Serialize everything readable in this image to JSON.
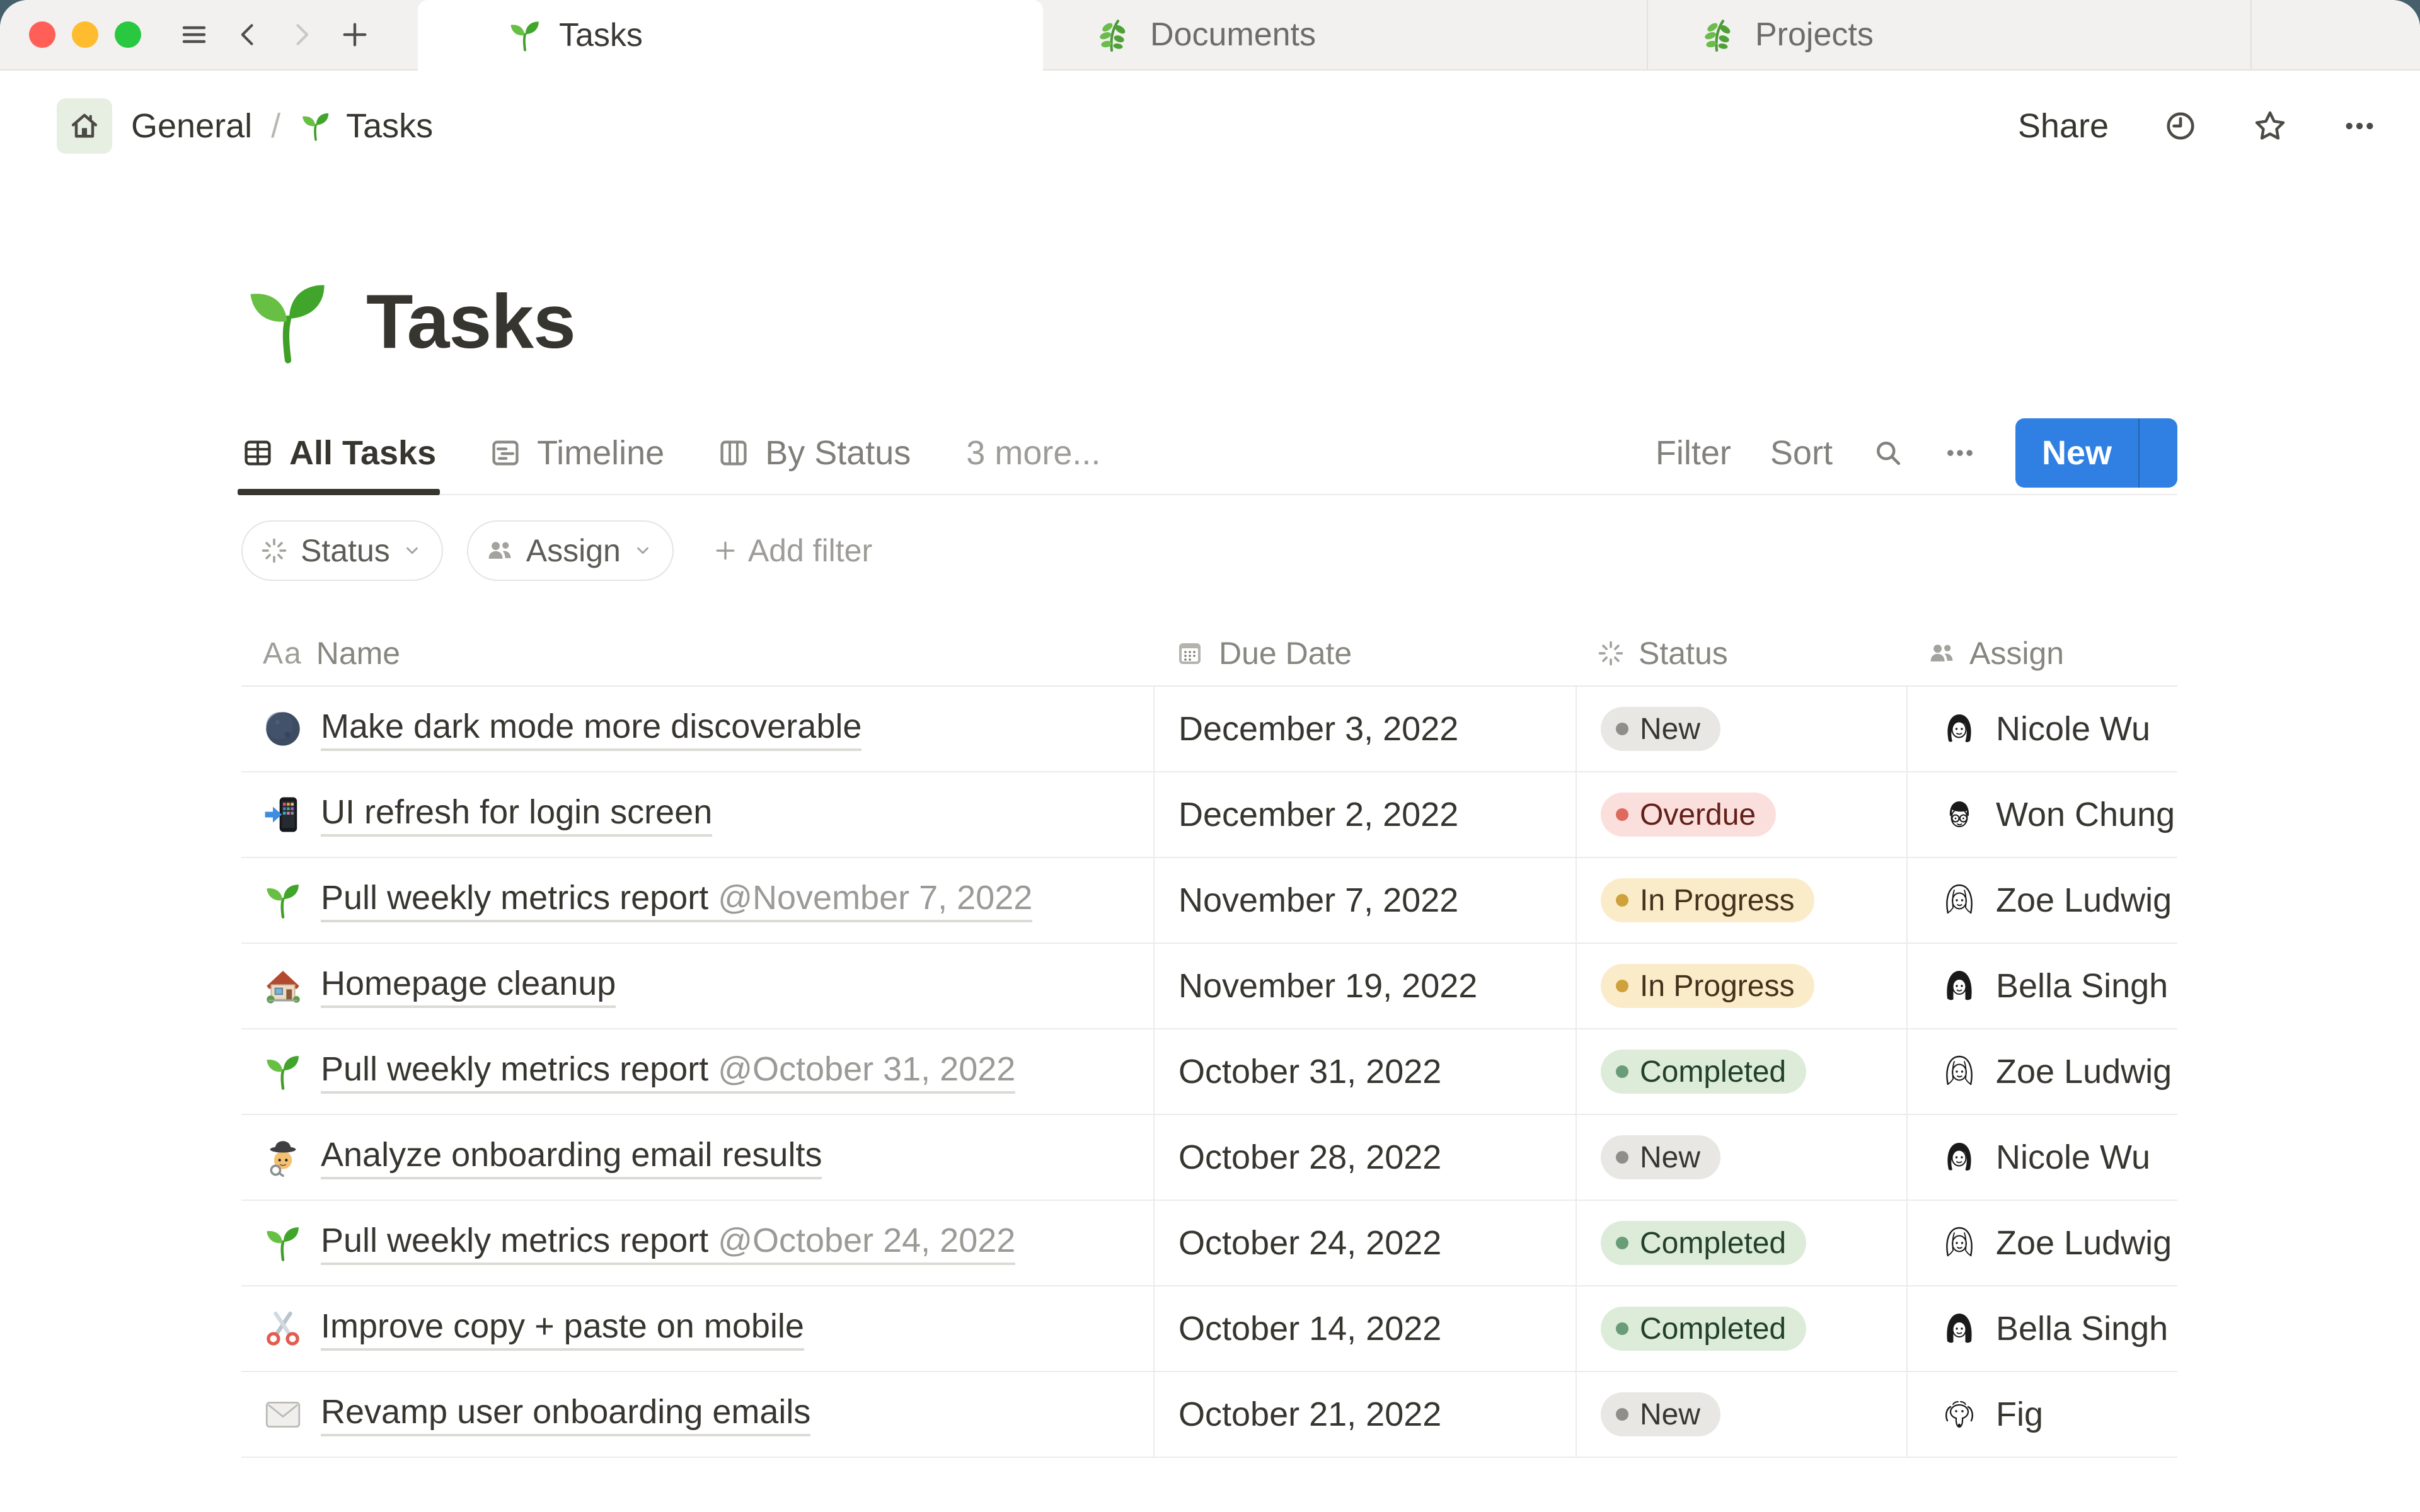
{
  "window": {
    "backdrop_color": "#45606a",
    "traffic_lights": [
      "#ff5f57",
      "#febc2e",
      "#28c840"
    ]
  },
  "tab_bar": {
    "tabs": [
      {
        "label": "Tasks",
        "icon": "seedling-icon",
        "active": true
      },
      {
        "label": "Documents",
        "icon": "herb-icon",
        "active": false
      },
      {
        "label": "Projects",
        "icon": "herb-icon",
        "active": false
      }
    ],
    "nav_icons": [
      "hamburger-icon",
      "chevron-left-icon",
      "chevron-right-icon",
      "plus-icon"
    ]
  },
  "breadcrumb": {
    "home_icon": "home-icon",
    "items": [
      {
        "label": "General"
      },
      {
        "label": "Tasks",
        "icon": "seedling-icon"
      }
    ],
    "separator": "/"
  },
  "toolbar": {
    "share_label": "Share",
    "icons": [
      "clock-icon",
      "star-icon",
      "ellipsis-icon"
    ]
  },
  "page": {
    "icon": "seedling-icon",
    "title": "Tasks"
  },
  "views": {
    "tabs": [
      {
        "label": "All Tasks",
        "icon": "table-view-icon",
        "active": true
      },
      {
        "label": "Timeline",
        "icon": "timeline-view-icon",
        "active": false
      },
      {
        "label": "By Status",
        "icon": "board-view-icon",
        "active": false
      }
    ],
    "more_label": "3 more...",
    "controls": {
      "filter_label": "Filter",
      "sort_label": "Sort",
      "search_icon": "search-icon",
      "more_icon": "ellipsis-gray-icon",
      "new_button": {
        "label": "New",
        "color": "#2f80e2",
        "caret_icon": "caret-down-white-icon"
      }
    }
  },
  "filter_bar": {
    "chips": [
      {
        "label": "Status",
        "icon": "status-burst-icon",
        "caret": "chevron-down-icon"
      },
      {
        "label": "Assign",
        "icon": "people-icon",
        "caret": "chevron-down-icon"
      }
    ],
    "add_filter_label": "Add filter",
    "add_icon": "plus-gray-icon"
  },
  "table": {
    "columns": [
      {
        "label": "Name",
        "icon": "aa-icon"
      },
      {
        "label": "Due Date",
        "icon": "calendar-icon"
      },
      {
        "label": "Status",
        "icon": "status-burst-icon"
      },
      {
        "label": "Assign",
        "icon": "people-icon"
      }
    ],
    "status_styles": {
      "New": {
        "bg": "#e8e7e4",
        "dot": "#8f8e8a",
        "text": "#383631"
      },
      "Overdue": {
        "bg": "#fbdfdc",
        "dot": "#de6a5e",
        "text": "#63201a"
      },
      "In Progress": {
        "bg": "#fbecc9",
        "dot": "#cfa13c",
        "text": "#43311c"
      },
      "Completed": {
        "bg": "#dcecd9",
        "dot": "#699c77",
        "text": "#22402c"
      }
    },
    "rows": [
      {
        "icon": "new-moon-icon",
        "name": "Make dark mode more discoverable",
        "mention": "",
        "due_date": "December 3, 2022",
        "status": "New",
        "assignee": "Nicole Wu",
        "avatar": "nicole-avatar"
      },
      {
        "icon": "phone-arrow-icon",
        "name": "UI refresh for login screen",
        "mention": "",
        "due_date": "December 2, 2022",
        "status": "Overdue",
        "assignee": "Won Chung",
        "avatar": "won-avatar"
      },
      {
        "icon": "seedling-icon",
        "name": "Pull weekly metrics report",
        "mention": "@November 7, 2022",
        "due_date": "November 7, 2022",
        "status": "In Progress",
        "assignee": "Zoe Ludwig",
        "avatar": "zoe-avatar"
      },
      {
        "icon": "house-icon",
        "name": "Homepage cleanup",
        "mention": "",
        "due_date": "November 19, 2022",
        "status": "In Progress",
        "assignee": "Bella Singh",
        "avatar": "bella-avatar"
      },
      {
        "icon": "seedling-icon",
        "name": "Pull weekly metrics report",
        "mention": "@October 31, 2022",
        "due_date": "October 31, 2022",
        "status": "Completed",
        "assignee": "Zoe Ludwig",
        "avatar": "zoe-avatar"
      },
      {
        "icon": "detective-icon",
        "name": "Analyze onboarding email results",
        "mention": "",
        "due_date": "October 28, 2022",
        "status": "New",
        "assignee": "Nicole Wu",
        "avatar": "nicole-avatar"
      },
      {
        "icon": "seedling-icon",
        "name": "Pull weekly metrics report",
        "mention": "@October 24, 2022",
        "due_date": "October 24, 2022",
        "status": "Completed",
        "assignee": "Zoe Ludwig",
        "avatar": "zoe-avatar"
      },
      {
        "icon": "scissors-icon",
        "name": "Improve copy + paste on mobile",
        "mention": "",
        "due_date": "October 14, 2022",
        "status": "Completed",
        "assignee": "Bella Singh",
        "avatar": "bella-avatar"
      },
      {
        "icon": "envelope-icon",
        "name": "Revamp user onboarding emails",
        "mention": "",
        "due_date": "October 21, 2022",
        "status": "New",
        "assignee": "Fig",
        "avatar": "fig-avatar"
      }
    ]
  }
}
